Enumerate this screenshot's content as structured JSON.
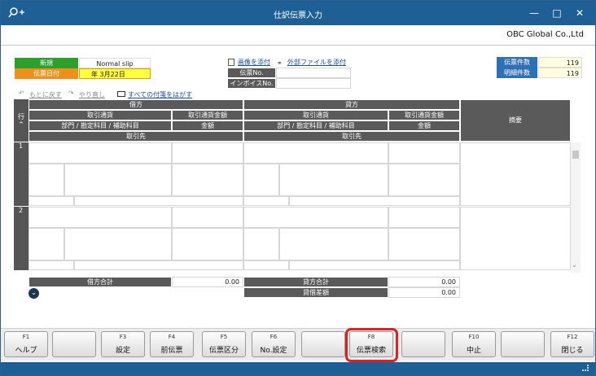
{
  "window": {
    "title": "仕訳伝票入力",
    "company": "OBC Global Co.,Ltd"
  },
  "slip": {
    "new_label": "新規",
    "type_value": "Normal slip",
    "date_label": "伝票日付",
    "date_value": "年  3月22日"
  },
  "links": {
    "attach_image": "画像を添付",
    "attach_external": "外部ファイルを添付",
    "remove_tags": "すべての付箋をはがす"
  },
  "slip_no": {
    "label": "伝票No.",
    "value": ""
  },
  "invoice_no": {
    "label": "インボイスNo.",
    "value": ""
  },
  "counts": {
    "slip_count_label": "伝票件数",
    "slip_count": "119",
    "detail_count_label": "明細件数",
    "detail_count": "119"
  },
  "undo": {
    "undo": "もとに戻す",
    "redo": "やり直し"
  },
  "grid": {
    "row_label": "行",
    "debit": "借方",
    "credit": "貸方",
    "currency": "取引通貨",
    "currency_amount": "取引通貨金額",
    "dept_account": "部門 / 勘定科目 / 補助科目",
    "amount": "金額",
    "partner": "取引先",
    "memo": "摘要",
    "rows": [
      "1",
      "2"
    ]
  },
  "totals": {
    "debit_total_label": "借方合計",
    "debit_total": "0.00",
    "credit_total_label": "貸方合計",
    "credit_total": "0.00",
    "diff_label": "貸借差額",
    "diff": "0.00"
  },
  "fkeys": [
    {
      "key": "F1",
      "label": "ヘルプ"
    },
    {
      "key": "",
      "label": ""
    },
    {
      "key": "F3",
      "label": "設定"
    },
    {
      "key": "F4",
      "label": "前伝票"
    },
    {
      "key": "F5",
      "label": "伝票区分"
    },
    {
      "key": "F6",
      "label": "No.設定"
    },
    {
      "key": "",
      "label": ""
    },
    {
      "key": "F8",
      "label": "伝票検索"
    },
    {
      "key": "",
      "label": ""
    },
    {
      "key": "F10",
      "label": "中止"
    },
    {
      "key": "",
      "label": ""
    },
    {
      "key": "F12",
      "label": "閉じる"
    }
  ],
  "colors": {
    "titlebar": "#1e5f96",
    "green": "#2ca02c",
    "orange": "#f0901a",
    "highlight": "#e02020",
    "count_label": "#2f6fb3"
  }
}
